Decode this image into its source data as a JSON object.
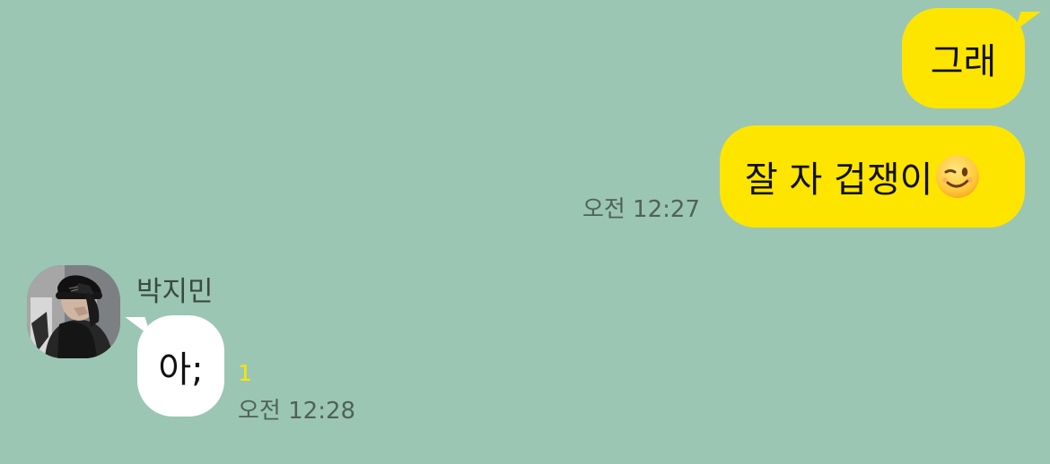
{
  "app": {
    "title": "KakaoTalk chat"
  },
  "colors": {
    "background": "#9bc6b3",
    "my_bubble": "#fee500",
    "their_bubble": "#ffffff",
    "unread": "#fee500"
  },
  "messages": {
    "m1": {
      "text": "그래"
    },
    "m2": {
      "text": "잘 자 겁쟁이",
      "emoji": "winking-face-icon",
      "time": "오전 12:27"
    },
    "m3": {
      "sender": "박지민",
      "text": "아;",
      "unread_count": "1",
      "time": "오전 12:28"
    }
  }
}
